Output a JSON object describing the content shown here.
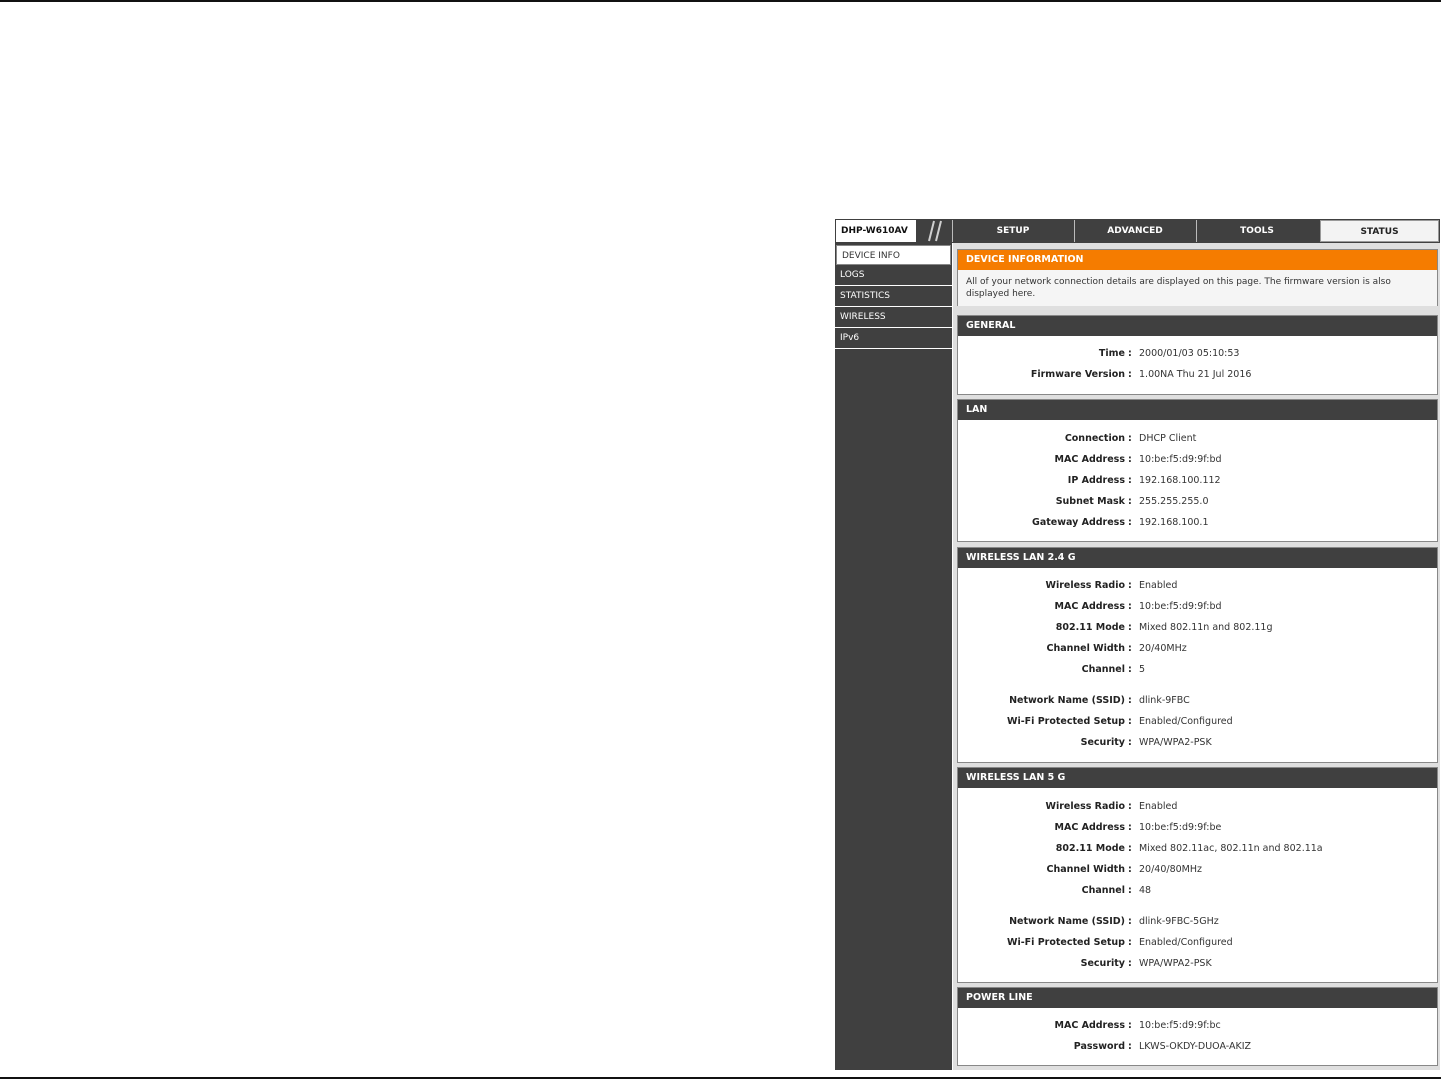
{
  "header": {
    "model": "DHP-W610AV",
    "tabs": [
      "SETUP",
      "ADVANCED",
      "TOOLS",
      "STATUS"
    ],
    "active_tab": "STATUS"
  },
  "sidebar": {
    "items": [
      "DEVICE INFO",
      "LOGS",
      "STATISTICS",
      "WIRELESS",
      "IPv6"
    ],
    "active": "DEVICE INFO"
  },
  "device_info": {
    "title": "DEVICE INFORMATION",
    "description": "All of your network connection details are displayed on this page. The firmware version is also displayed here."
  },
  "general": {
    "title": "GENERAL",
    "rows": [
      {
        "label": "Time",
        "value": "2000/01/03 05:10:53"
      },
      {
        "label": "Firmware Version",
        "value": "1.00NA Thu 21 Jul 2016"
      }
    ]
  },
  "lan": {
    "title": "LAN",
    "rows": [
      {
        "label": "Connection",
        "value": "DHCP Client"
      },
      {
        "label": "MAC Address",
        "value": "10:be:f5:d9:9f:bd"
      },
      {
        "label": "IP Address",
        "value": "192.168.100.112"
      },
      {
        "label": "Subnet Mask",
        "value": "255.255.255.0"
      },
      {
        "label": "Gateway Address",
        "value": "192.168.100.1"
      }
    ]
  },
  "wlan24": {
    "title": "WIRELESS LAN 2.4 G",
    "rows": [
      {
        "label": "Wireless Radio",
        "value": "Enabled"
      },
      {
        "label": "MAC Address",
        "value": "10:be:f5:d9:9f:bd"
      },
      {
        "label": "802.11 Mode",
        "value": "Mixed 802.11n and 802.11g"
      },
      {
        "label": "Channel Width",
        "value": "20/40MHz"
      },
      {
        "label": "Channel",
        "value": "5"
      },
      {
        "label": "Network Name (SSID)",
        "value": "dlink-9FBC"
      },
      {
        "label": "Wi-Fi Protected Setup",
        "value": "Enabled/Configured"
      },
      {
        "label": "Security",
        "value": "WPA/WPA2-PSK"
      }
    ]
  },
  "wlan5": {
    "title": "WIRELESS LAN 5 G",
    "rows": [
      {
        "label": "Wireless Radio",
        "value": "Enabled"
      },
      {
        "label": "MAC Address",
        "value": "10:be:f5:d9:9f:be"
      },
      {
        "label": "802.11 Mode",
        "value": "Mixed 802.11ac, 802.11n and 802.11a"
      },
      {
        "label": "Channel Width",
        "value": "20/40/80MHz"
      },
      {
        "label": "Channel",
        "value": "48"
      },
      {
        "label": "Network Name (SSID)",
        "value": "dlink-9FBC-5GHz"
      },
      {
        "label": "Wi-Fi Protected Setup",
        "value": "Enabled/Configured"
      },
      {
        "label": "Security",
        "value": "WPA/WPA2-PSK"
      }
    ]
  },
  "powerline": {
    "title": "POWER LINE",
    "rows": [
      {
        "label": "MAC Address",
        "value": "10:be:f5:d9:9f:bc"
      },
      {
        "label": "Password",
        "value": "LKWS-OKDY-DUOA-AKIZ"
      }
    ]
  },
  "separator": ":",
  "colors": {
    "header_bg": "#404040",
    "accent": "#f57c00",
    "content_bg": "#dfdfdf"
  }
}
